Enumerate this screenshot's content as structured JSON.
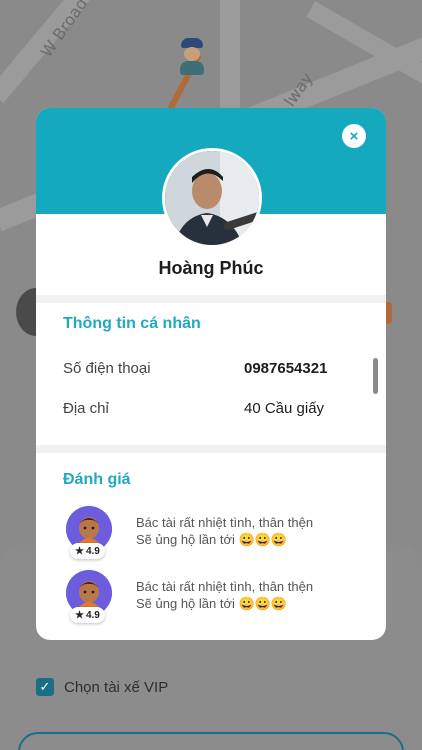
{
  "map": {
    "street_1": "W Broad",
    "street_2": "lway"
  },
  "profile": {
    "name": "Hoàng Phúc",
    "close_icon": "×"
  },
  "personal_info": {
    "title": "Thông tin cá nhân",
    "phone_label": "Số điện thoại",
    "phone_value": "0987654321",
    "address_label": "Địa chỉ",
    "address_value": "40 Cầu giấy"
  },
  "reviews": {
    "title": "Đánh giá",
    "items": [
      {
        "rating": "4.9",
        "line1": "Bác tài rất nhiệt tình, thân thện",
        "line2": "Sẽ ủng hộ lần tới 😀😀😀"
      },
      {
        "rating": "4.9",
        "line1": "Bác tài rất nhiệt tình, thân thện",
        "line2": "Sẽ ủng hộ lần tới 😀😀😀"
      }
    ]
  },
  "sheet": {
    "vip_checkbox_label": "Chọn tài xế VIP",
    "check_mark": "✓"
  },
  "colors": {
    "accent": "#14a9be",
    "title_accent": "#22a9c1",
    "avatar_purple": "#6d5ddc"
  }
}
